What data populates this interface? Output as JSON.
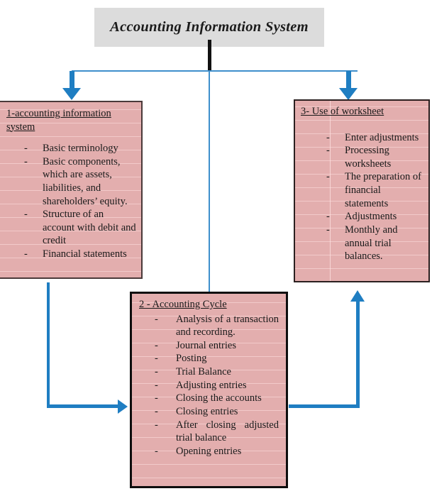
{
  "diagram": {
    "title": "Accounting Information System",
    "accent_blue": "#1f7ec2",
    "connector_blue": "#3f8fcc",
    "box_fill": "#e3aeae",
    "title_fill": "#dcdcdc",
    "bullet_dash": "-",
    "boxes": {
      "box1": {
        "heading": "1-accounting information system",
        "items": [
          "Basic terminology",
          "Basic components, which are assets, liabilities, and shareholders’ equity.",
          "Structure of an account with debit and credit",
          "Financial statements"
        ]
      },
      "box2": {
        "heading": "2 - Accounting Cycle",
        "items": [
          "Analysis of a transaction and recording.",
          "Journal entries",
          "Posting",
          "Trial Balance",
          "Adjusting entries",
          "Closing the accounts",
          "Closing entries",
          "After closing adjusted trial balance",
          "Opening entries"
        ]
      },
      "box3": {
        "heading": "3- Use of worksheet",
        "items": [
          "Enter adjustments",
          "Processing worksheets",
          "The preparation of financial statements",
          "Adjustments",
          "Monthly and annual trial balances."
        ]
      }
    }
  }
}
